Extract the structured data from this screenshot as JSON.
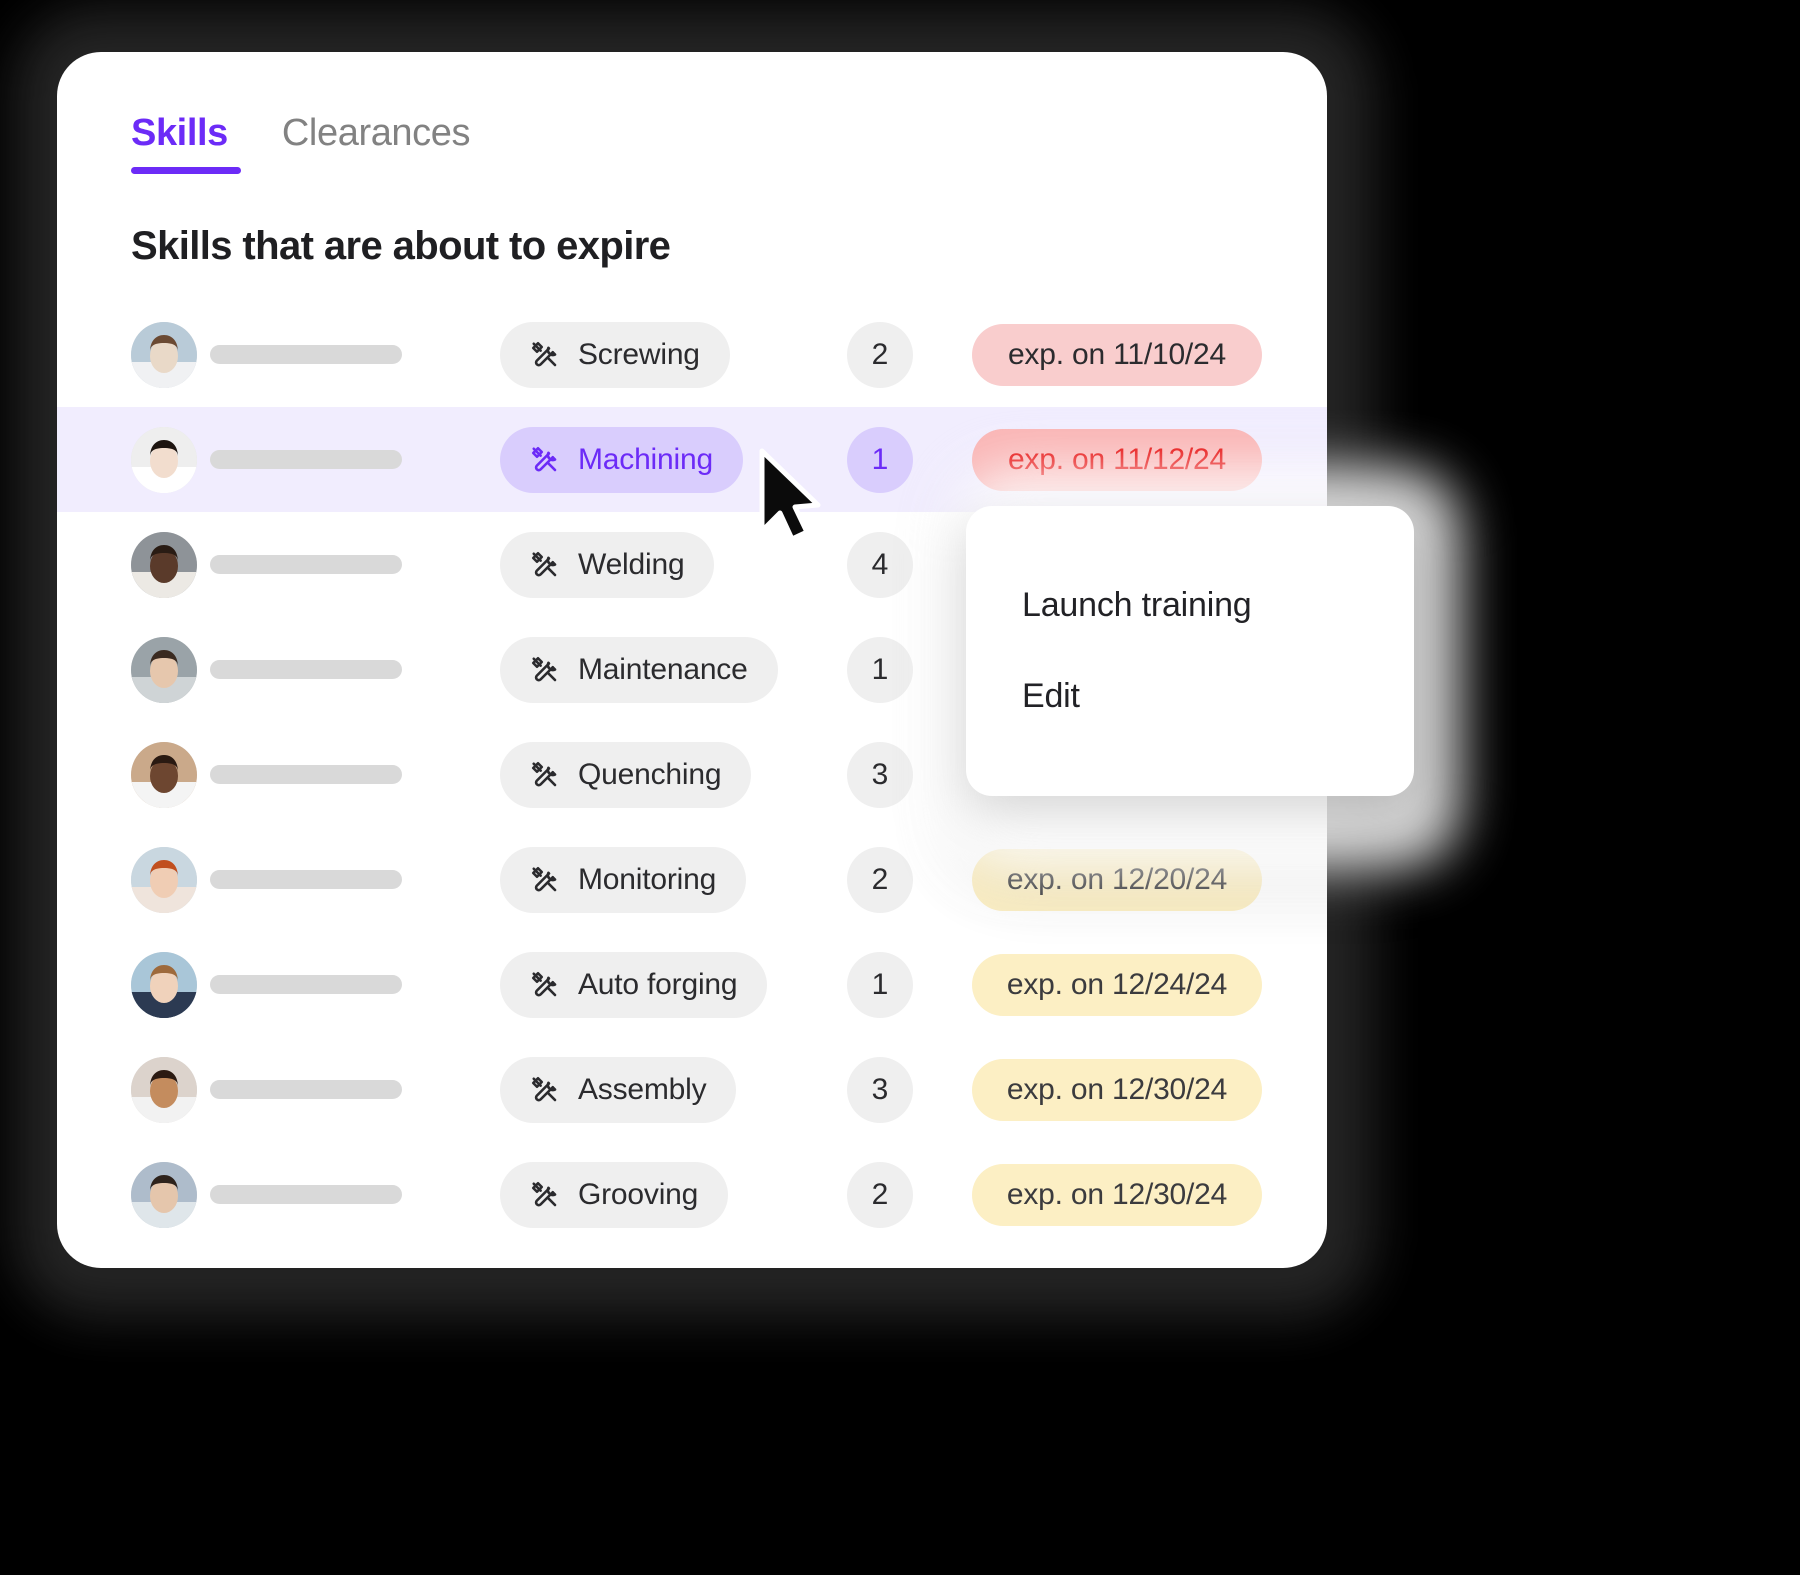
{
  "tabs": [
    {
      "label": "Skills",
      "active": true,
      "name": "tab-skills"
    },
    {
      "label": "Clearances",
      "active": false,
      "name": "tab-clearances"
    }
  ],
  "section": {
    "title": "Skills that are about to expire"
  },
  "colors": {
    "accent": "#6C2BF7",
    "row_highlight": "#F1EDFE",
    "pill_default": "#EFEFEF",
    "pill_active": "#D9CDFD",
    "badge_red": "#F9CDCD",
    "badge_red_strong": "#FAB5B5",
    "badge_red_text": "#E60000",
    "badge_yellow": "#FCEFC4",
    "name_bar": "#D9D9D9",
    "backdrop": "#000000"
  },
  "icons": {
    "tools": "tools-icon",
    "cursor": "mouse-pointer-icon"
  },
  "rows": [
    {
      "skill": "Screwing",
      "count": "2",
      "expiry": "exp. on 11/10/24",
      "severity": "red",
      "highlight": false,
      "menu_covered": false
    },
    {
      "skill": "Machining",
      "count": "1",
      "expiry": "exp. on 11/12/24",
      "severity": "red-strong",
      "highlight": true,
      "menu_covered": false
    },
    {
      "skill": "Welding",
      "count": "4",
      "expiry": "",
      "severity": "red",
      "highlight": false,
      "menu_covered": true
    },
    {
      "skill": "Maintenance",
      "count": "1",
      "expiry": "",
      "severity": "red",
      "highlight": false,
      "menu_covered": true
    },
    {
      "skill": "Quenching",
      "count": "3",
      "expiry": "",
      "severity": "yellow",
      "highlight": false,
      "menu_covered": true
    },
    {
      "skill": "Monitoring",
      "count": "2",
      "expiry": "exp. on 12/20/24",
      "severity": "yellow",
      "highlight": false,
      "menu_covered": false
    },
    {
      "skill": "Auto forging",
      "count": "1",
      "expiry": "exp. on 12/24/24",
      "severity": "yellow",
      "highlight": false,
      "menu_covered": false
    },
    {
      "skill": "Assembly",
      "count": "3",
      "expiry": "exp. on 12/30/24",
      "severity": "yellow",
      "highlight": false,
      "menu_covered": false
    },
    {
      "skill": "Grooving",
      "count": "2",
      "expiry": "exp. on 12/30/24",
      "severity": "yellow",
      "highlight": false,
      "menu_covered": false
    }
  ],
  "context_menu": {
    "items": [
      {
        "label": "Launch training",
        "name": "menu-item-launch-training"
      },
      {
        "label": "Edit",
        "name": "menu-item-edit"
      }
    ]
  }
}
